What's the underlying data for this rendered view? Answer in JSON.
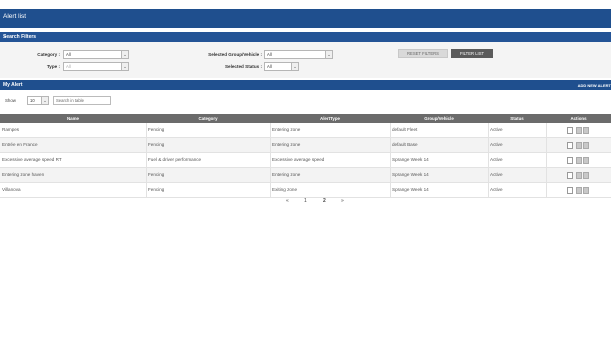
{
  "window": {
    "title": "Alert list"
  },
  "filters": {
    "bar_title": "Search Filters",
    "category": {
      "label": "Category :",
      "value": "All"
    },
    "type": {
      "label": "Type :",
      "value": "All"
    },
    "group_vehicle": {
      "label": "Selected Group/Vehicle :",
      "value": "All"
    },
    "status": {
      "label": "Selected Status :",
      "value": "All"
    },
    "reset_label": "RESET FILTERS",
    "filter_label": "FILTER LIST"
  },
  "my_alert": {
    "title": "My Alert",
    "add_label": "ADD NEW ALERT",
    "show_label": "Show",
    "page_size": "10",
    "search_placeholder": "Search in table"
  },
  "table": {
    "columns": [
      "Name",
      "Category",
      "AlertType",
      "Group/Vehicle",
      "Status",
      "Actions"
    ],
    "rows": [
      [
        "Rampes",
        "Fencing",
        "Entering zone",
        "default Fleet",
        "Active"
      ],
      [
        "Entrée en France",
        "Fencing",
        "Entering zone",
        "default Base",
        "Active"
      ],
      [
        "Excessive average speed RT",
        "Fuel & driver performance",
        "Excessive average speed",
        "Sprange Week 14",
        "Active"
      ],
      [
        "Entering zone haven",
        "Fencing",
        "Entering zone",
        "Sprange Week 14",
        "Active"
      ],
      [
        "Villanova",
        "Fencing",
        "Exiting zone",
        "Sprange Week 14",
        "Active"
      ]
    ]
  },
  "pagination": {
    "prev": "«",
    "pages": [
      "1",
      "2"
    ],
    "current": "2",
    "next": "»"
  },
  "colors": {
    "header_blue": "#1f4f8e",
    "table_head": "#6b6b6b",
    "button_dark": "#5b5b5b"
  },
  "icons": [
    "chevron-down-icon",
    "edit-icon",
    "copy-icon",
    "delete-icon"
  ]
}
